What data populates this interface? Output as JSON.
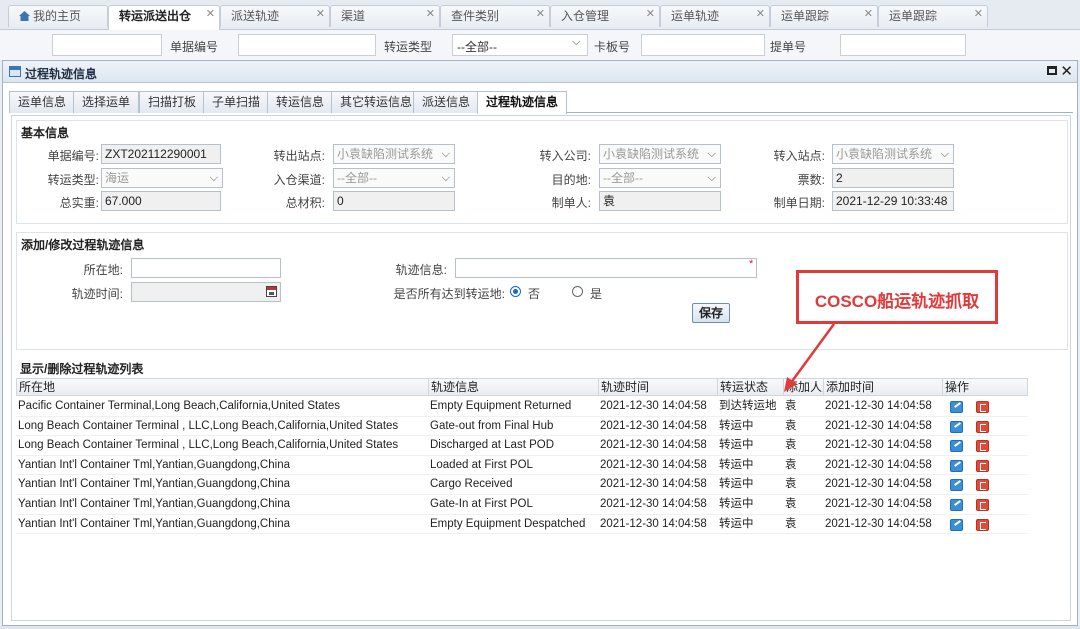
{
  "top_tabs": [
    {
      "label": "我的主页",
      "active": false
    },
    {
      "label": "转运派送出仓",
      "active": true
    },
    {
      "label": "派送轨迹",
      "active": false
    },
    {
      "label": "渠道",
      "active": false
    },
    {
      "label": "查件类别",
      "active": false
    },
    {
      "label": "入仓管理",
      "active": false
    },
    {
      "label": "运单轨迹",
      "active": false
    },
    {
      "label": "运单跟踪",
      "active": false
    },
    {
      "label": "运单跟踪",
      "active": false
    }
  ],
  "bg_search": {
    "doc_no_label": "单据编号",
    "transfer_type_label": "转运类型",
    "transfer_type_value": "--全部--",
    "board_no_label": "卡板号",
    "bill_no_label": "提单号"
  },
  "dialog": {
    "title": "过程轨迹信息",
    "tabs": [
      "运单信息",
      "选择运单",
      "扫描打板",
      "子单扫描",
      "转运信息",
      "其它转运信息",
      "派送信息",
      "过程轨迹信息"
    ],
    "active_tab": 7
  },
  "basic": {
    "title": "基本信息",
    "doc_no_label": "单据编号:",
    "doc_no": "ZXT202112290001",
    "out_station_label": "转出站点:",
    "out_station": "小袁缺陷测试系统",
    "in_company_label": "转入公司:",
    "in_company": "小袁缺陷测试系统",
    "in_station_label": "转入站点:",
    "in_station": "小袁缺陷测试系统",
    "transfer_type_label": "转运类型:",
    "transfer_type": "海运",
    "channel_label": "入仓渠道:",
    "channel": "--全部--",
    "destination_label": "目的地:",
    "destination": "--全部--",
    "votes_label": "票数:",
    "votes": "2",
    "weight_label": "总实重:",
    "weight": "67.000",
    "volume_label": "总材积:",
    "volume": "0",
    "creator_label": "制单人:",
    "creator": "袁",
    "create_date_label": "制单日期:",
    "create_date": "2021-12-29 10:33:48"
  },
  "edit": {
    "title": "添加/修改过程轨迹信息",
    "location_label": "所在地:",
    "location_value": "",
    "track_info_label": "轨迹信息:",
    "track_info_value": "",
    "track_time_label": "轨迹时间:",
    "all_arrived_label": "是否所有达到转运地:",
    "no_label": "否",
    "yes_label": "是",
    "selected": "否",
    "save_label": "保存"
  },
  "list": {
    "title": "显示/删除过程轨迹列表",
    "columns": [
      "所在地",
      "轨迹信息",
      "轨迹时间",
      "转运状态",
      "添加人",
      "添加时间",
      "操作"
    ],
    "rows": [
      {
        "location": "Pacific Container Terminal,Long Beach,California,United States",
        "info": "Empty Equipment Returned",
        "time": "2021-12-30 14:04:58",
        "status": "到达转运地",
        "adder": "袁",
        "added": "2021-12-30 14:04:58"
      },
      {
        "location": "Long Beach Container Terminal , LLC,Long Beach,California,United States",
        "info": "Gate-out from Final Hub",
        "time": "2021-12-30 14:04:58",
        "status": "转运中",
        "adder": "袁",
        "added": "2021-12-30 14:04:58"
      },
      {
        "location": "Long Beach Container Terminal , LLC,Long Beach,California,United States",
        "info": "Discharged at Last POD",
        "time": "2021-12-30 14:04:58",
        "status": "转运中",
        "adder": "袁",
        "added": "2021-12-30 14:04:58"
      },
      {
        "location": "Yantian Int'l Container Tml,Yantian,Guangdong,China",
        "info": "Loaded at First POL",
        "time": "2021-12-30 14:04:58",
        "status": "转运中",
        "adder": "袁",
        "added": "2021-12-30 14:04:58"
      },
      {
        "location": "Yantian Int'l Container Tml,Yantian,Guangdong,China",
        "info": "Cargo Received",
        "time": "2021-12-30 14:04:58",
        "status": "转运中",
        "adder": "袁",
        "added": "2021-12-30 14:04:58"
      },
      {
        "location": "Yantian Int'l Container Tml,Yantian,Guangdong,China",
        "info": "Gate-In at First POL",
        "time": "2021-12-30 14:04:58",
        "status": "转运中",
        "adder": "袁",
        "added": "2021-12-30 14:04:58"
      },
      {
        "location": "Yantian Int'l Container Tml,Yantian,Guangdong,China",
        "info": "Empty Equipment Despatched",
        "time": "2021-12-30 14:04:58",
        "status": "转运中",
        "adder": "袁",
        "added": "2021-12-30 14:04:58"
      }
    ]
  },
  "annotation": {
    "text": "COSCO船运轨迹抓取",
    "color": "#e03a3a"
  },
  "icons": {
    "home": "home-icon",
    "window": "window-icon",
    "maximize": "maximize-icon",
    "close": "close-icon",
    "calendar": "calendar-icon",
    "edit": "edit-icon",
    "delete": "delete-icon"
  }
}
